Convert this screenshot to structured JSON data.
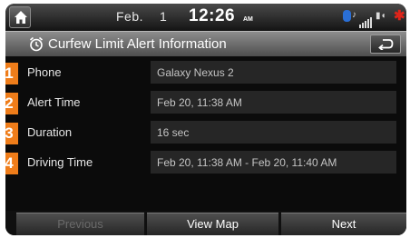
{
  "status_bar": {
    "month": "Feb.",
    "day": "1",
    "time": "12:26",
    "ampm": "AM"
  },
  "title_bar": {
    "title": "Curfew Limit Alert Information"
  },
  "rows": [
    {
      "number": "1",
      "label": "Phone",
      "value": "Galaxy Nexus 2"
    },
    {
      "number": "2",
      "label": "Alert Time",
      "value": "Feb 20, 11:38 AM"
    },
    {
      "number": "3",
      "label": "Duration",
      "value": "16 sec"
    },
    {
      "number": "4",
      "label": "Driving Time",
      "value": "Feb 20, 11:38 AM - Feb 20, 11:40 AM"
    }
  ],
  "buttons": {
    "previous": "Previous",
    "view_map": "View Map",
    "next": "Next"
  },
  "colors": {
    "badge": "#ef7d1a",
    "bluetooth": "#2a6fd6",
    "alert_star": "#e0241a"
  },
  "icons": {
    "home": "home-icon",
    "alarm": "alarm-clock-icon",
    "back": "back-arrow-icon"
  }
}
